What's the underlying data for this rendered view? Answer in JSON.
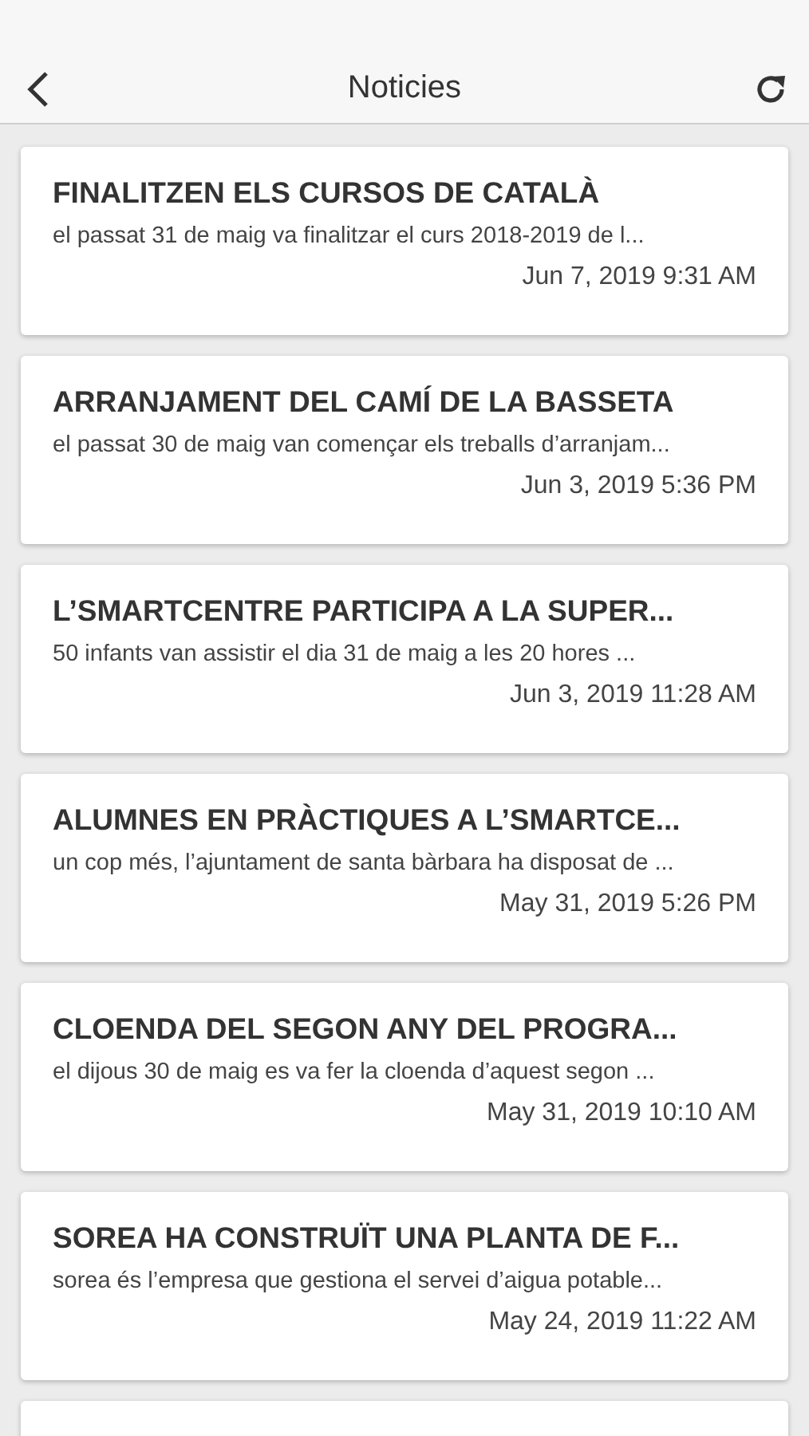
{
  "header": {
    "title": "Noticies"
  },
  "news": [
    {
      "kind": "article",
      "title": "FINALITZEN ELS CURSOS DE CATALÀ",
      "summary": "el passat 31 de maig va finalitzar el curs 2018-2019 de l...",
      "date": "Jun 7, 2019 9:31 AM"
    },
    {
      "kind": "article",
      "title": "ARRANJAMENT DEL CAMÍ DE LA BASSETA",
      "summary": "el passat 30 de maig van començar els treballs d’arranjam...",
      "date": "Jun 3, 2019 5:36 PM"
    },
    {
      "kind": "article",
      "title": "L’SMARTCENTRE PARTICIPA A LA SUPER...",
      "summary": "50 infants van assistir el dia 31 de maig a les 20 hores ...",
      "date": "Jun 3, 2019 11:28 AM"
    },
    {
      "kind": "article",
      "title": "ALUMNES EN PRÀCTIQUES A L’SMARTCE...",
      "summary": "un cop més, l’ajuntament de santa bàrbara ha disposat de ...",
      "date": "May 31, 2019 5:26 PM"
    },
    {
      "kind": "article",
      "title": "CLOENDA DEL SEGON ANY DEL PROGRA...",
      "summary": "el dijous 30 de maig es va fer la cloenda d’aquest segon ...",
      "date": "May 31, 2019 10:10 AM"
    },
    {
      "kind": "article",
      "title": "SOREA HA CONSTRUÏT UNA PLANTA DE F...",
      "summary": "sorea és l’empresa que gestiona el servei d’aigua potable...",
      "date": "May 24, 2019 11:22 AM"
    },
    {
      "kind": "partial"
    }
  ]
}
